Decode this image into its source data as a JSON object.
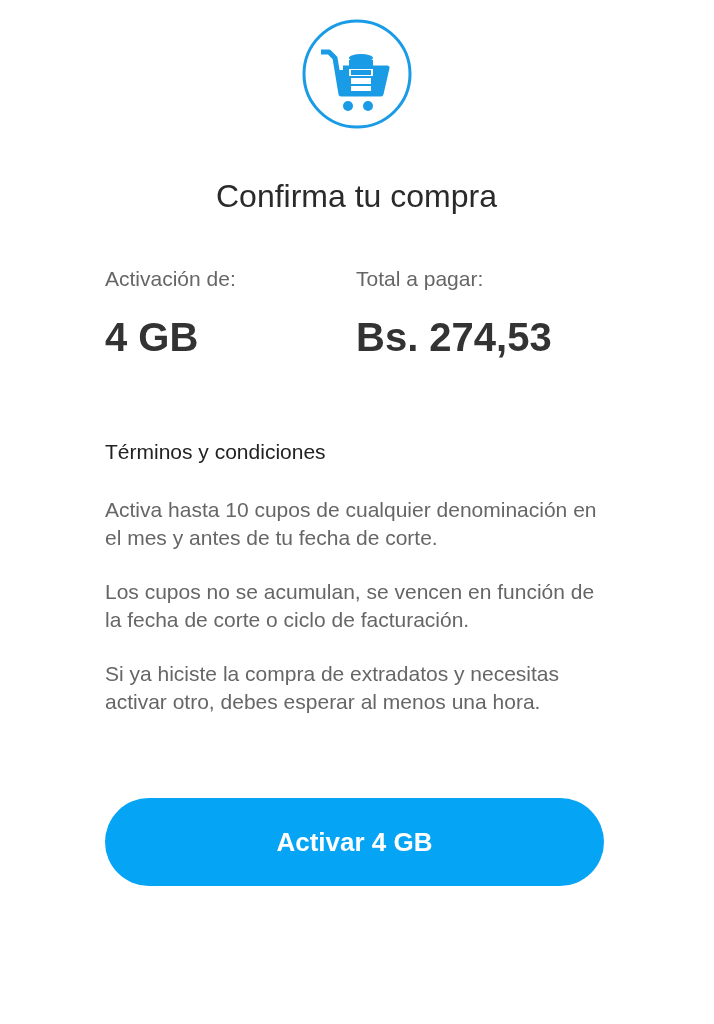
{
  "title": "Confirma tu compra",
  "summary": [
    {
      "label": "Activación de:",
      "value": "4 GB"
    },
    {
      "label": "Total a pagar:",
      "value": "Bs. 274,53"
    }
  ],
  "terms": {
    "heading": "Términos y condiciones",
    "paragraphs": [
      "Activa hasta 10 cupos de cualquier denominación en el mes y antes de tu fecha de corte.",
      "Los cupos no se acumulan, se vencen en función de la fecha de corte o ciclo de facturación.",
      "Si ya hiciste la compra de extradatos y necesitas activar otro, debes esperar al menos una hora."
    ]
  },
  "button": "Activar 4 GB"
}
